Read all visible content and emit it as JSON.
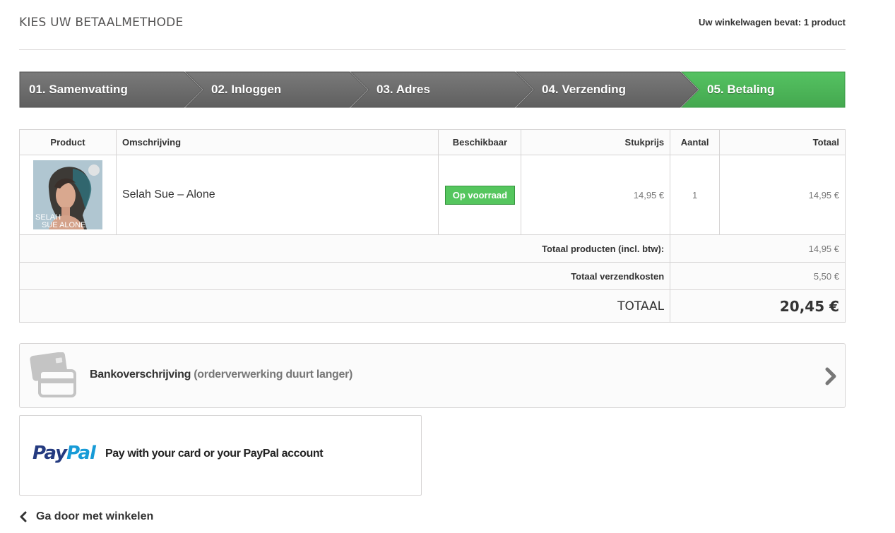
{
  "header": {
    "title": "KIES UW BETAALMETHODE",
    "cart_summary": "Uw winkelwagen bevat: 1 product"
  },
  "steps": [
    {
      "label": "01. Samenvatting",
      "active": false
    },
    {
      "label": "02. Inloggen",
      "active": false
    },
    {
      "label": "03. Adres",
      "active": false
    },
    {
      "label": "04. Verzending",
      "active": false
    },
    {
      "label": "05. Betaling",
      "active": true
    }
  ],
  "colors": {
    "step_inactive": "#6f6f6f",
    "step_active": "#4bb45a",
    "stock_badge": "#55c65e",
    "paypal_dark": "#253b80",
    "paypal_light": "#179bd7"
  },
  "cart": {
    "columns": {
      "product": "Product",
      "description": "Omschrijving",
      "availability": "Beschikbaar",
      "unit_price": "Stukprijs",
      "quantity": "Aantal",
      "total": "Totaal"
    },
    "items": [
      {
        "image_text": [
          "SELAH",
          "SUE ALONE"
        ],
        "description": "Selah Sue – Alone",
        "availability": "Op voorraad",
        "unit_price": "14,95 €",
        "quantity": "1",
        "total": "14,95 €"
      }
    ],
    "totals": {
      "products_label": "Totaal producten (incl. btw):",
      "products_value": "14,95 €",
      "shipping_label": "Totaal verzendkosten",
      "shipping_value": "5,50 €",
      "grand_label": "TOTAAL",
      "grand_value": "20,45 €"
    }
  },
  "payment": {
    "bank": {
      "label": "Bankoverschrijving",
      "note": "(orderverwerking duurt langer)",
      "icon": "credit-card-icon"
    },
    "paypal": {
      "logo_part1": "Pay",
      "logo_part2": "Pal",
      "label": "Pay with your card or your PayPal account"
    }
  },
  "footer": {
    "continue_label": "Ga door met winkelen"
  }
}
